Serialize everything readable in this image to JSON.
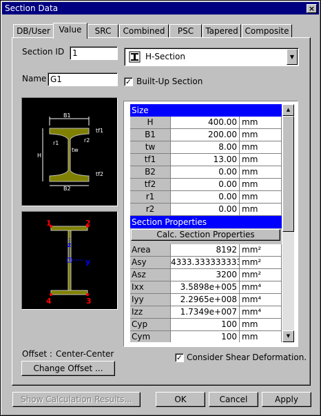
{
  "window": {
    "title": "Section Data",
    "close_label": "×"
  },
  "tabs": [
    {
      "label": "DB/User"
    },
    {
      "label": "Value"
    },
    {
      "label": "SRC"
    },
    {
      "label": "Combined"
    },
    {
      "label": "PSC"
    },
    {
      "label": "Tapered"
    },
    {
      "label": "Composite"
    }
  ],
  "form": {
    "section_id_label": "Section ID",
    "section_id_value": "1",
    "name_label": "Name",
    "name_value": "G1",
    "section_type": "H-Section",
    "built_up_label": "Built-Up Section",
    "built_up_checked": true
  },
  "diagram": {
    "labels": [
      "B1",
      "tf1",
      "r1",
      "r2",
      "H",
      "tw",
      "tf2",
      "B2"
    ],
    "points": [
      "1",
      "2",
      "3",
      "4"
    ],
    "axis": [
      "z",
      "y"
    ]
  },
  "grid": {
    "size_header": "Size",
    "size_rows": [
      {
        "name": "H",
        "value": "400.00",
        "unit": "mm"
      },
      {
        "name": "B1",
        "value": "200.00",
        "unit": "mm"
      },
      {
        "name": "tw",
        "value": "8.00",
        "unit": "mm"
      },
      {
        "name": "tf1",
        "value": "13.00",
        "unit": "mm"
      },
      {
        "name": "B2",
        "value": "0.00",
        "unit": "mm"
      },
      {
        "name": "tf2",
        "value": "0.00",
        "unit": "mm"
      },
      {
        "name": "r1",
        "value": "0.00",
        "unit": "mm"
      },
      {
        "name": "r2",
        "value": "0.00",
        "unit": "mm"
      }
    ],
    "props_header": "Section Properties",
    "calc_button": "Calc. Section Properties",
    "prop_rows": [
      {
        "name": "Area",
        "value": "8192",
        "unit": "mm²"
      },
      {
        "name": "Asy",
        "value": "4333.333333333",
        "unit": "mm²"
      },
      {
        "name": "Asz",
        "value": "3200",
        "unit": "mm²"
      },
      {
        "name": "Ixx",
        "value": "3.5898e+005",
        "unit": "mm⁴"
      },
      {
        "name": "Iyy",
        "value": "2.2965e+008",
        "unit": "mm⁴"
      },
      {
        "name": "Izz",
        "value": "1.7349e+007",
        "unit": "mm⁴"
      },
      {
        "name": "Cyp",
        "value": "100",
        "unit": "mm"
      },
      {
        "name": "Cym",
        "value": "100",
        "unit": "mm"
      }
    ]
  },
  "offset": {
    "label": "Offset :",
    "value": "Center-Center",
    "change_button": "Change Offset ..."
  },
  "shear": {
    "label": "Consider Shear Deformation.",
    "checked": true
  },
  "buttons": {
    "show_results": "Show Calculation Results...",
    "ok": "OK",
    "cancel": "Cancel",
    "apply": "Apply"
  },
  "colors": {
    "title_bg": "#000080",
    "header_bg": "#0000ff",
    "section_fill": "#808000",
    "point_color": "#ff0000",
    "axis_color": "#0000ff"
  }
}
